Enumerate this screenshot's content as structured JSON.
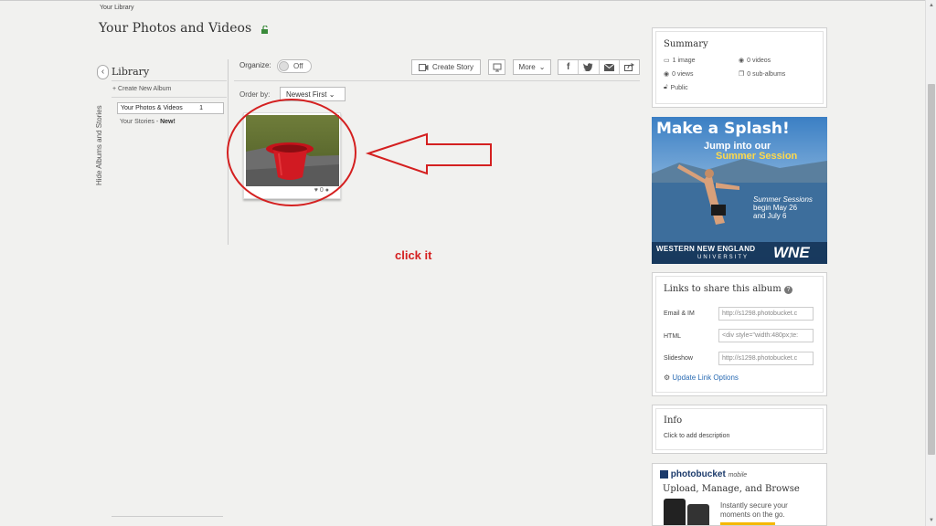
{
  "breadcrumb": "Your Library",
  "page_title": "Your Photos and Videos",
  "sidebar": {
    "hide_label": "Hide Albums and Stories",
    "title": "Library",
    "create_album": "+ Create New Album",
    "active_item": {
      "label": "Your Photos & Videos",
      "count": "1"
    },
    "stories_label": "Your Stories - ",
    "stories_new": "New!"
  },
  "toolbar": {
    "organize_label": "Organize:",
    "toggle_state": "Off",
    "create_story": "Create Story",
    "more": "More",
    "order_label": "Order by:",
    "order_value": "Newest First"
  },
  "thumbnail": {
    "likes": "0"
  },
  "annotation": {
    "text": "click it",
    "color": "#d42020"
  },
  "summary": {
    "title": "Summary",
    "images": "1 image",
    "videos": "0 videos",
    "views": "0 views",
    "sub_albums": "0 sub-albums",
    "privacy": "Public"
  },
  "ad": {
    "title": "Make a Splash!",
    "line1": "Jump into our",
    "line2": "Summer Session",
    "body1": "Summer Sessions",
    "body2": "begin May 26",
    "body3": "and July 6",
    "foot_name": "WESTERN NEW ENGLAND",
    "foot_uni": "UNIVERSITY",
    "logo": "WNE"
  },
  "links": {
    "title": "Links to share this album",
    "email_label": "Email & IM",
    "email_value": "http://s1298.photobucket.c",
    "html_label": "HTML",
    "html_value": "<div style=\"width:480px;te:",
    "slideshow_label": "Slideshow",
    "slideshow_value": "http://s1298.photobucket.c",
    "update": "Update Link Options"
  },
  "info": {
    "title": "Info",
    "sub": "Click to add description"
  },
  "promo": {
    "brand": "photobucket",
    "brand_suffix": "mobile",
    "title": "Upload, Manage, and Browse",
    "text": "Instantly secure your moments on the go."
  }
}
